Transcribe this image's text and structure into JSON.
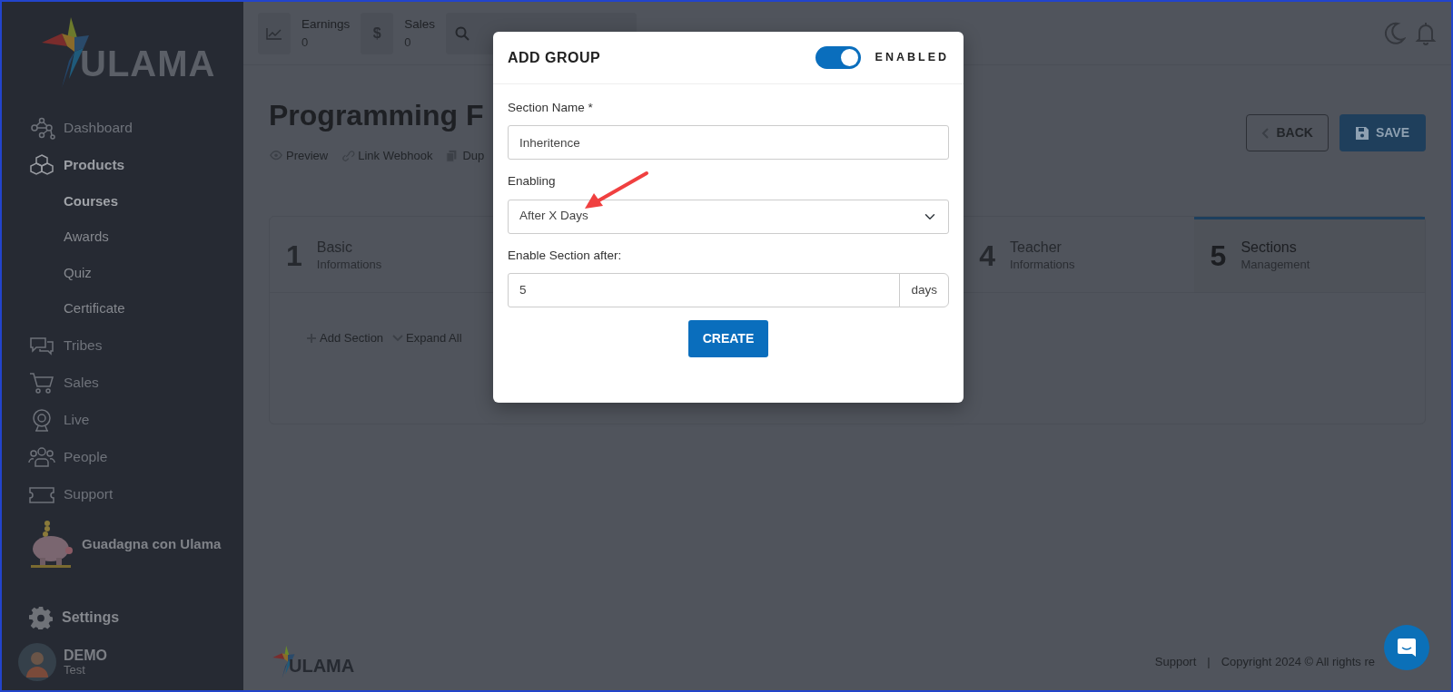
{
  "sidebar": {
    "logo": "ULAMA",
    "items": [
      {
        "label": "Dashboard",
        "selected": false
      },
      {
        "label": "Products",
        "selected": true,
        "children": [
          {
            "label": "Courses",
            "selected": true
          },
          {
            "label": "Awards",
            "selected": false
          },
          {
            "label": "Quiz",
            "selected": false
          },
          {
            "label": "Certificate",
            "selected": false
          }
        ]
      },
      {
        "label": "Tribes",
        "selected": false
      },
      {
        "label": "Sales",
        "selected": false
      },
      {
        "label": "Live",
        "selected": false
      },
      {
        "label": "People",
        "selected": false
      },
      {
        "label": "Support",
        "selected": false
      }
    ],
    "promo": "Guadagna con Ulama",
    "settings": "Settings",
    "user": {
      "name": "DEMO",
      "role": "Test"
    }
  },
  "topbar": {
    "stats": [
      {
        "label": "Earnings",
        "value": "0"
      },
      {
        "label": "Sales",
        "value": "0",
        "symbol": "$"
      }
    ]
  },
  "page": {
    "title": "Programming F",
    "links": [
      "Preview",
      "Link Webhook",
      "Dup"
    ],
    "back": "BACK",
    "save": "SAVE"
  },
  "steps": [
    {
      "number": "1",
      "title": "Basic",
      "subtitle": "Informations",
      "selected": false
    },
    {
      "number": "4",
      "title": "Teacher",
      "subtitle": "Informations",
      "selected": false
    },
    {
      "number": "5",
      "title": "Sections",
      "subtitle": "Management",
      "selected": true
    }
  ],
  "sections_toolbar": [
    "Add Section",
    "Expand All"
  ],
  "footer": {
    "logo": "ULAMA",
    "support": "Support",
    "separator": "|",
    "copyright": "Copyright 2024 © All rights re"
  },
  "modal": {
    "title": "ADD GROUP",
    "enabled": true,
    "enabled_label": "ENABLED",
    "fields": [
      {
        "kind": "text",
        "label": "Section Name *",
        "value": "Inheritence"
      },
      {
        "kind": "select",
        "label": "Enabling",
        "value": "After X Days"
      },
      {
        "kind": "addon",
        "label": "Enable Section after:",
        "value": "5",
        "addon": "days"
      }
    ],
    "create": "CREATE"
  }
}
